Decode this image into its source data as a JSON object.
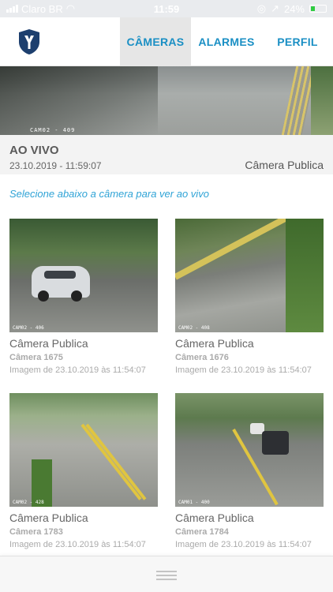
{
  "status_bar": {
    "carrier": "Claro BR",
    "time": "11:59",
    "battery": "24%",
    "icons": [
      "signal-icon",
      "wifi-icon",
      "lock-rotation-icon",
      "alarm-icon",
      "battery-icon"
    ]
  },
  "header": {
    "logo_icon": "shield-y-logo",
    "tabs": [
      {
        "label": "CÂMERAS",
        "active": true
      },
      {
        "label": "ALARMES",
        "active": false
      },
      {
        "label": "PERFIL",
        "active": false
      }
    ],
    "accent_color": "#1a8fc4"
  },
  "live": {
    "overlay_label": "CAM02 - 409",
    "title": "AO VIVO",
    "datetime": "23.10.2019 - 11:59:07",
    "camera_name": "Câmera Publica"
  },
  "instruction": "Selecione abaixo a câmera para ver ao vivo",
  "cameras": [
    {
      "title": "Câmera Publica",
      "id": "Câmera 1675",
      "timestamp": "Imagem de 23.10.2019 às 11:54:07",
      "overlay": "CAM02 - 406"
    },
    {
      "title": "Câmera Publica",
      "id": "Câmera 1676",
      "timestamp": "Imagem de 23.10.2019 às 11:54:07",
      "overlay": "CAM02 - 408"
    },
    {
      "title": "Câmera Publica",
      "id": "Câmera 1783",
      "timestamp": "Imagem de 23.10.2019 às 11:54:07",
      "overlay": "CAM02 - 428"
    },
    {
      "title": "Câmera Publica",
      "id": "Câmera 1784",
      "timestamp": "Imagem de 23.10.2019 às 11:54:07",
      "overlay": "CAM01 - 400"
    }
  ],
  "bottom_bar": {
    "handle_icon": "drag-handle-icon"
  }
}
